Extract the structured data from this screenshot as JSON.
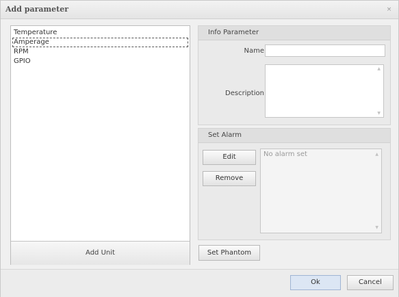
{
  "window": {
    "title": "Add parameter",
    "close_glyph": "×"
  },
  "units": {
    "items": [
      "Temperature",
      "Amperage",
      "RPM",
      "GPIO"
    ],
    "selected_index": 1,
    "add_button": "Add Unit"
  },
  "info": {
    "title": "Info Parameter",
    "name_label": "Name",
    "name_value": "",
    "description_label": "Description",
    "description_value": ""
  },
  "alarm": {
    "title": "Set Alarm",
    "edit_button": "Edit",
    "remove_button": "Remove",
    "status_text": "No alarm set"
  },
  "actions": {
    "set_phantom": "Set Phantom",
    "ok": "Ok",
    "cancel": "Cancel"
  },
  "colors": {
    "ok_button_bg": "#dce6f4"
  }
}
